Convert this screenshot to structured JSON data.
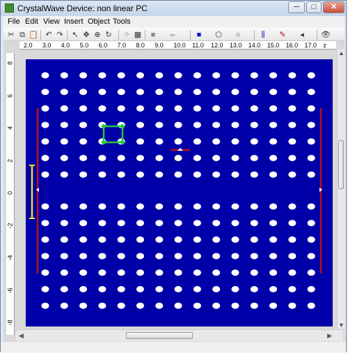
{
  "window": {
    "title": "CrystalWave Device: non linear PC",
    "controls": {
      "minimize": "─",
      "maximize": "□",
      "close": "✕"
    }
  },
  "menu": {
    "items": [
      "File",
      "Edit",
      "View",
      "Insert",
      "Object",
      "Tools"
    ]
  },
  "toolbar": {
    "buttons": [
      {
        "name": "cut-icon",
        "glyph": "✂"
      },
      {
        "name": "copy-icon",
        "glyph": "⧉"
      },
      {
        "name": "paste-icon",
        "glyph": "📋"
      },
      {
        "name": "undo-icon",
        "glyph": "↶"
      },
      {
        "name": "redo-icon",
        "glyph": "↷"
      },
      {
        "name": "select-icon",
        "glyph": "↖"
      },
      {
        "name": "move-icon",
        "glyph": "✥"
      },
      {
        "name": "zoom-icon",
        "glyph": "⊕"
      },
      {
        "name": "rotate-icon",
        "glyph": "↻"
      },
      {
        "name": "pattern-icon",
        "glyph": "⁘"
      },
      {
        "name": "grid-icon",
        "glyph": "▦"
      },
      {
        "name": "fill-gray-icon",
        "glyph": "■"
      },
      {
        "name": "align-icon",
        "glyph": "⇔"
      },
      {
        "name": "fill-blue-icon",
        "glyph": "■"
      },
      {
        "name": "polygon-icon",
        "glyph": "⬠"
      },
      {
        "name": "circle-icon",
        "glyph": "○"
      },
      {
        "name": "source-icon",
        "glyph": "⫼"
      },
      {
        "name": "probe-icon",
        "glyph": "✎"
      },
      {
        "name": "monitor-icon",
        "glyph": "◂"
      },
      {
        "name": "view-icon",
        "glyph": "👁"
      }
    ]
  },
  "ruler": {
    "x_ticks": [
      "2.0",
      "3.0",
      "4.0",
      "5.0",
      "6.0",
      "7.0",
      "8.0",
      "9.0",
      "10.0",
      "11.0",
      "12.0",
      "13.0",
      "14.0",
      "15.0",
      "16.0",
      "17.0",
      "z"
    ],
    "y_ticks": [
      "8",
      "6",
      "4",
      "2",
      "0",
      "-2",
      "-4",
      "-6",
      "-8"
    ]
  },
  "colors": {
    "background": "#0000a8",
    "hole": "#ffffff",
    "selection": "#22c944",
    "source": "#b5121b",
    "probe": "#f0e020"
  },
  "lattice": {
    "columns": 15,
    "rows_top": 7,
    "rows_bottom": 7
  }
}
